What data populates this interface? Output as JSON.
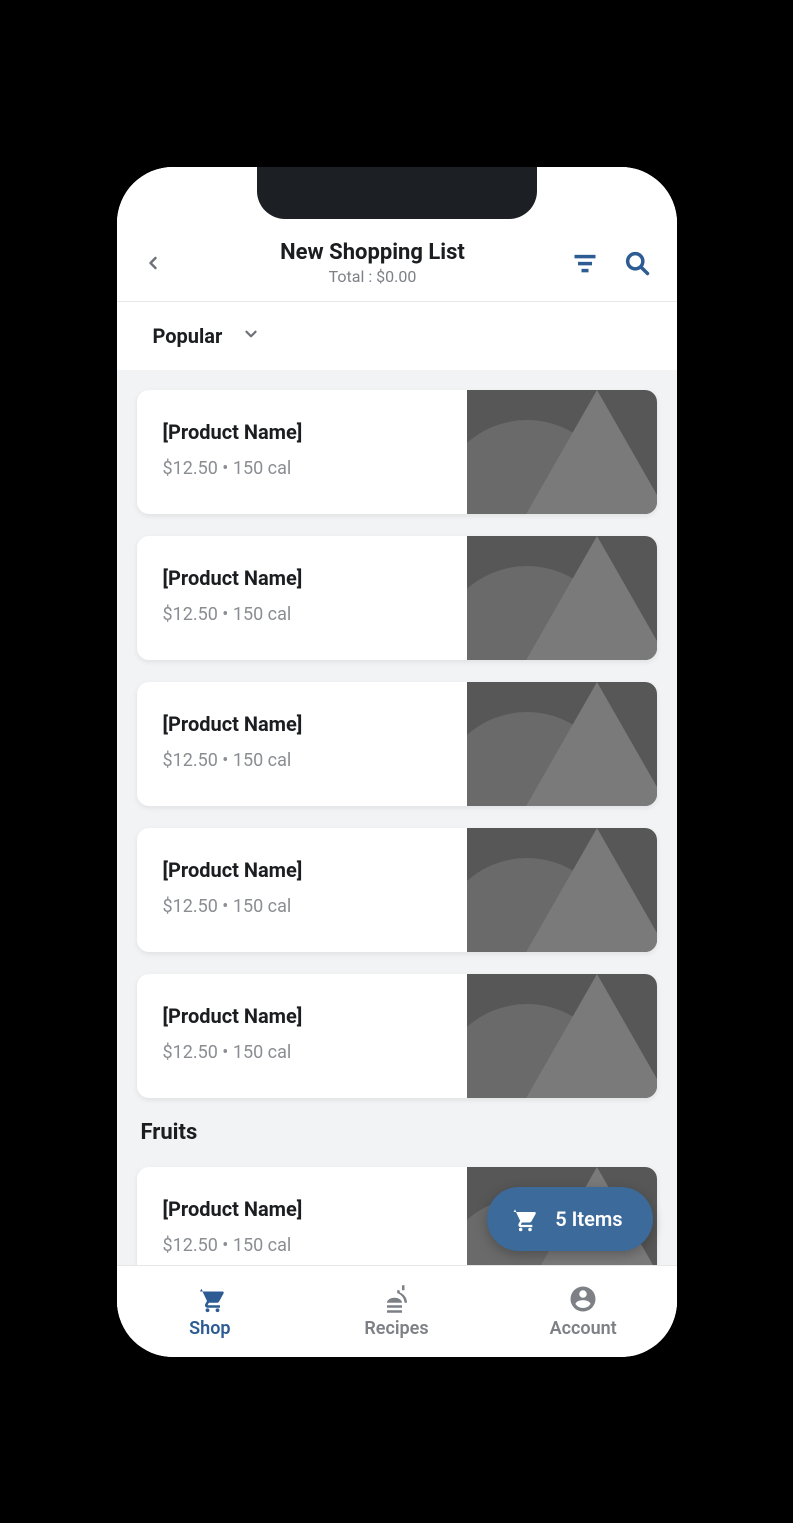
{
  "header": {
    "title": "New Shopping List",
    "subtitle": "Total : $0.00"
  },
  "sort": {
    "label": "Popular"
  },
  "sections": [
    {
      "label": null,
      "items": [
        {
          "name": "[Product Name]",
          "meta": "$12.50 • 150 cal"
        },
        {
          "name": "[Product Name]",
          "meta": "$12.50 • 150 cal"
        },
        {
          "name": "[Product Name]",
          "meta": "$12.50 • 150 cal"
        },
        {
          "name": "[Product Name]",
          "meta": "$12.50 • 150 cal"
        },
        {
          "name": "[Product Name]",
          "meta": "$12.50 • 150 cal"
        }
      ]
    },
    {
      "label": "Fruits",
      "items": [
        {
          "name": "[Product Name]",
          "meta": "$12.50 • 150 cal"
        }
      ]
    }
  ],
  "cart_pill": {
    "label": "5 Items"
  },
  "nav": {
    "items": [
      {
        "label": "Shop",
        "active": true
      },
      {
        "label": "Recipes",
        "active": false
      },
      {
        "label": "Account",
        "active": false
      }
    ]
  }
}
